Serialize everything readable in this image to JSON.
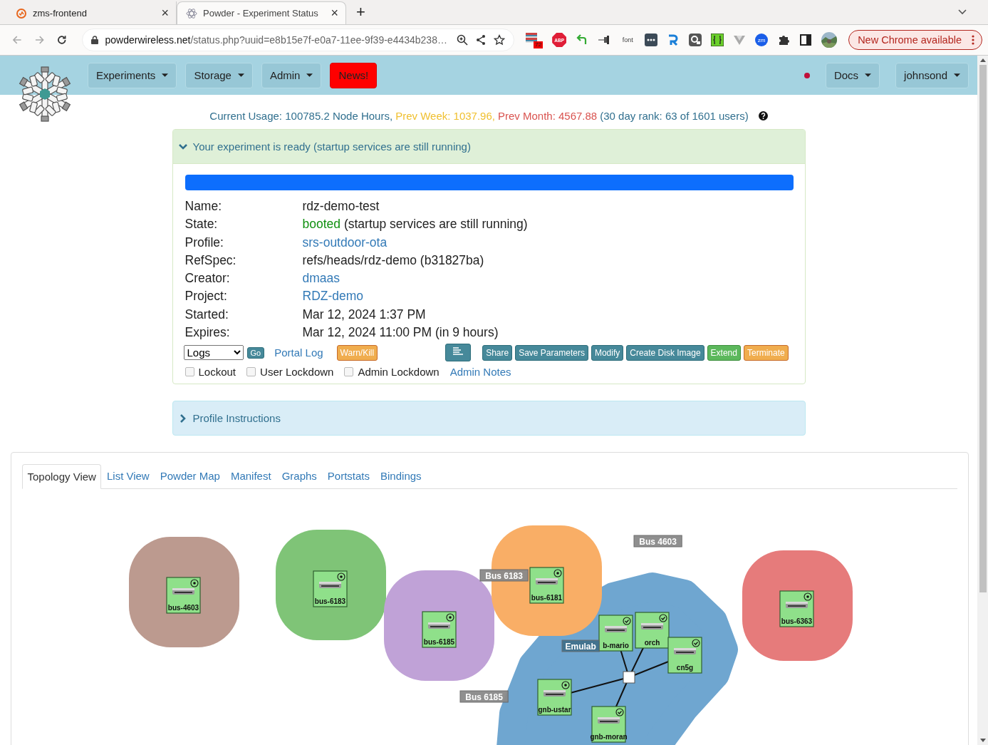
{
  "browser": {
    "tabs": [
      {
        "title": "zms-frontend",
        "selected": false,
        "close": "×"
      },
      {
        "title": "Powder - Experiment Status",
        "selected": true,
        "close": "×"
      }
    ],
    "new_tab": "+",
    "address": {
      "host": "powderwireless.net",
      "path": "/status.php?uuid=e8b15e7f-e0a7-11ee-9f39-e4434b238…"
    },
    "extensions": [
      {
        "kind": "badge",
        "text": "72"
      },
      {
        "kind": "abp",
        "text": "ABP"
      },
      {
        "kind": "arrow"
      },
      {
        "kind": "pin"
      },
      {
        "kind": "font",
        "text": "font"
      },
      {
        "kind": "dots"
      },
      {
        "kind": "r"
      },
      {
        "kind": "cam"
      },
      {
        "kind": "braces"
      },
      {
        "kind": "vee"
      },
      {
        "kind": "zm",
        "text": "zm"
      },
      {
        "kind": "puzzle"
      },
      {
        "kind": "sidebar"
      },
      {
        "kind": "avatar"
      }
    ],
    "update_button": "New Chrome available"
  },
  "nav": {
    "menus": [
      {
        "label": "Experiments",
        "kind": "dropdown"
      },
      {
        "label": "Storage",
        "kind": "dropdown"
      },
      {
        "label": "Admin",
        "kind": "dropdown"
      },
      {
        "label": "News!",
        "kind": "alert"
      }
    ],
    "right": [
      {
        "label": "Docs",
        "kind": "dropdown"
      },
      {
        "label": "johnsond",
        "kind": "dropdown"
      }
    ]
  },
  "usage": [
    {
      "text": "Current Usage: 100785.2 Node Hours,",
      "color": "#31708f"
    },
    {
      "text": "Prev Week: 1037.96,",
      "color": "#f0c030"
    },
    {
      "text": "Prev Month: 4567.88",
      "color": "#d9534f"
    },
    {
      "text": "(30 day rank: 63 of 1601 users)",
      "color": "#31708f"
    }
  ],
  "status_panel": {
    "title": "Your experiment is ready (startup services are still running)",
    "expanded": true,
    "progress": {
      "level": 1
    },
    "fields": [
      {
        "label": "Name:",
        "value": "rdz-demo-test",
        "kind": "text"
      },
      {
        "label": "State:",
        "value": "booted",
        "note": "(startup services are still running)",
        "kind": "state"
      },
      {
        "label": "Profile:",
        "value": "srs-outdoor-ota",
        "kind": "link"
      },
      {
        "label": "RefSpec:",
        "value": "refs/heads/rdz-demo (b31827ba)",
        "kind": "text"
      },
      {
        "label": "Creator:",
        "value": "dmaas",
        "kind": "link"
      },
      {
        "label": "Project:",
        "value": "RDZ-demo",
        "kind": "link"
      },
      {
        "label": "Started:",
        "value": "Mar 12, 2024 1:37 PM",
        "kind": "text"
      },
      {
        "label": "Expires:",
        "value": "Mar 12, 2024 11:00 PM (in 9 hours)",
        "kind": "text"
      }
    ],
    "logs_select": "Logs",
    "go_button": "Go",
    "portal_log": "Portal Log",
    "warn_kill": "Warn/Kill",
    "actions": [
      {
        "label": "Share",
        "kind": "info"
      },
      {
        "label": "Save Parameters",
        "kind": "info"
      },
      {
        "label": "Modify",
        "kind": "info"
      },
      {
        "label": "Create Disk Image",
        "kind": "info"
      },
      {
        "label": "Extend",
        "kind": "success"
      },
      {
        "label": "Terminate",
        "kind": "warning"
      }
    ],
    "checkboxes": [
      {
        "label": "Lockout",
        "checked": false
      },
      {
        "label": "User Lockdown",
        "checked": false
      },
      {
        "label": "Admin Lockdown",
        "checked": false
      }
    ],
    "admin_notes": "Admin Notes"
  },
  "instructions_panel": {
    "title": "Profile Instructions",
    "expanded": false
  },
  "view_tabs": [
    {
      "label": "Topology View",
      "selected": true
    },
    {
      "label": "List View",
      "selected": false
    },
    {
      "label": "Powder Map",
      "selected": false
    },
    {
      "label": "Manifest",
      "selected": false
    },
    {
      "label": "Graphs",
      "selected": false
    },
    {
      "label": "Portstats",
      "selected": false
    },
    {
      "label": "Bindings",
      "selected": false
    }
  ],
  "topology": {
    "clusters": [
      {
        "color": "#bc9a8f"
      },
      {
        "color": "#7fc477"
      },
      {
        "color": "#c0a2d7"
      },
      {
        "color": "#6fa6d0"
      },
      {
        "color": "#f9ae66"
      },
      {
        "color": "#e67b7b"
      }
    ],
    "nodes": [
      {
        "name": "bus-4603",
        "ready": false
      },
      {
        "name": "bus-6183",
        "ready": false
      },
      {
        "name": "bus-6185",
        "ready": false
      },
      {
        "name": "bus-6181",
        "ready": false
      },
      {
        "name": "bus-6363",
        "ready": false
      },
      {
        "name": "b-mario",
        "ready": true
      },
      {
        "name": "orch",
        "ready": true
      },
      {
        "name": "cn5g",
        "ready": true
      },
      {
        "name": "gnb-ustar",
        "ready": false
      },
      {
        "name": "gnb-moran",
        "ready": true
      }
    ],
    "labels": [
      {
        "text": "Bus 4603",
        "kind": "bus"
      },
      {
        "text": "Bus 6183",
        "kind": "bus"
      },
      {
        "text": "Bus 6185",
        "kind": "bus"
      },
      {
        "text": "Emulab",
        "kind": "site"
      }
    ]
  }
}
